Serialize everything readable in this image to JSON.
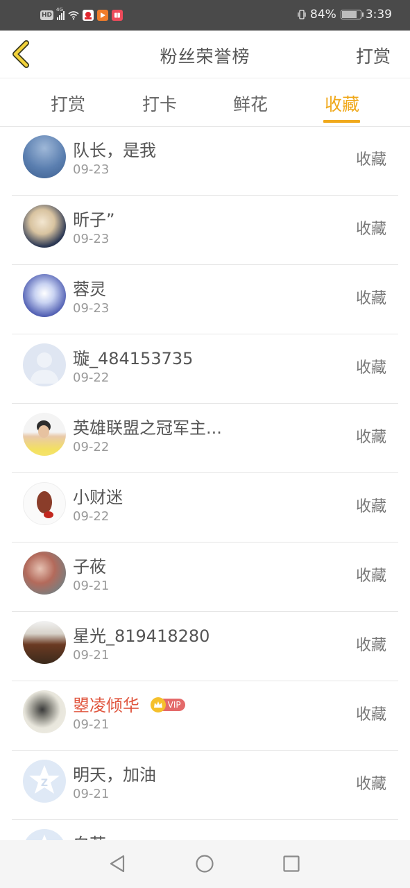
{
  "status_bar": {
    "hd": "HD",
    "network": "4G",
    "battery_text": "84%",
    "battery_level": 0.84,
    "time": "3:39"
  },
  "nav": {
    "title": "粉丝荣誉榜",
    "action": "打赏",
    "back_icon": "chevron-left-icon",
    "accent_color": "#f0a91c"
  },
  "tabs": [
    {
      "label": "打赏",
      "active": false
    },
    {
      "label": "打卡",
      "active": false
    },
    {
      "label": "鲜花",
      "active": false
    },
    {
      "label": "收藏",
      "active": true
    }
  ],
  "fans": [
    {
      "name": "队长，是我",
      "date": "09-23",
      "action": "收藏",
      "vip": false
    },
    {
      "name": "昕子”",
      "date": "09-23",
      "action": "收藏",
      "vip": false
    },
    {
      "name": "蓉灵",
      "date": "09-23",
      "action": "收藏",
      "vip": false
    },
    {
      "name": "璇_484153735",
      "date": "09-22",
      "action": "收藏",
      "vip": false
    },
    {
      "name": "英雄联盟之冠军主...",
      "date": "09-22",
      "action": "收藏",
      "vip": false
    },
    {
      "name": "小财迷",
      "date": "09-22",
      "action": "收藏",
      "vip": false
    },
    {
      "name": "子莜",
      "date": "09-21",
      "action": "收藏",
      "vip": false
    },
    {
      "name": "星光_819418280",
      "date": "09-21",
      "action": "收藏",
      "vip": false
    },
    {
      "name": "曌凌倾华",
      "date": "09-21",
      "action": "收藏",
      "vip": true,
      "vip_label": "VIP"
    },
    {
      "name": "明天，加油",
      "date": "09-21",
      "action": "收藏",
      "vip": false
    },
    {
      "name": "白苔",
      "date": "",
      "action": "",
      "vip": false
    }
  ],
  "system_nav": {
    "back": "back-triangle-icon",
    "home": "home-circle-icon",
    "recents": "recents-square-icon"
  }
}
